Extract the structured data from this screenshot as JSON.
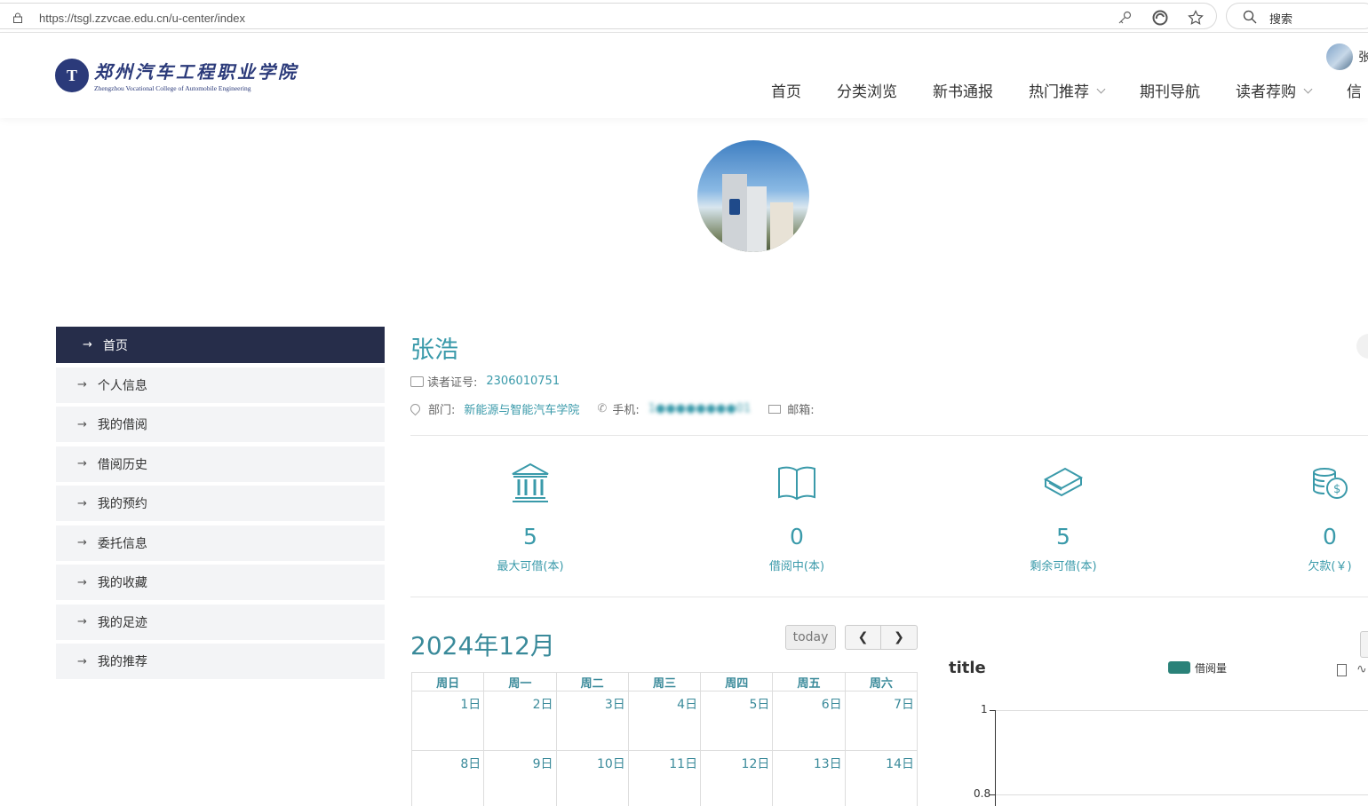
{
  "browser": {
    "url": "https://tsgl.zzvcae.edu.cn/u-center/index",
    "search_placeholder": "搜索"
  },
  "header": {
    "logo_cn": "郑州汽车工程职业学院",
    "logo_en": "Zhengzhou Vocational College of Automobile Engineering",
    "user_short": "张",
    "nav": [
      {
        "label": "首页",
        "dropdown": false
      },
      {
        "label": "分类浏览",
        "dropdown": false
      },
      {
        "label": "新书通报",
        "dropdown": false
      },
      {
        "label": "热门推荐",
        "dropdown": true
      },
      {
        "label": "期刊导航",
        "dropdown": false
      },
      {
        "label": "读者荐购",
        "dropdown": true
      },
      {
        "label": "信",
        "dropdown": false
      }
    ]
  },
  "sidebar": {
    "items": [
      {
        "label": "首页",
        "active": true
      },
      {
        "label": "个人信息",
        "active": false
      },
      {
        "label": "我的借阅",
        "active": false
      },
      {
        "label": "借阅历史",
        "active": false
      },
      {
        "label": "我的预约",
        "active": false
      },
      {
        "label": "委托信息",
        "active": false
      },
      {
        "label": "我的收藏",
        "active": false
      },
      {
        "label": "我的足迹",
        "active": false
      },
      {
        "label": "我的推荐",
        "active": false
      }
    ]
  },
  "user": {
    "name": "张浩",
    "card_label": "读者证号:",
    "card_no": "2306010751",
    "dept_label": "部门:",
    "dept": "新能源与智能汽车学院",
    "phone_label": "手机:",
    "phone": "1●●●●●●●●01",
    "email_label": "邮箱:"
  },
  "stats": [
    {
      "icon": "bank-icon",
      "value": "5",
      "label": "最大可借(本)"
    },
    {
      "icon": "open-book-icon",
      "value": "0",
      "label": "借阅中(本)"
    },
    {
      "icon": "book-stack-icon",
      "value": "5",
      "label": "剩余可借(本)"
    },
    {
      "icon": "coins-icon",
      "value": "0",
      "label": "欠款(￥)"
    }
  ],
  "calendar": {
    "title": "2024年12月",
    "today_label": "today",
    "weekdays": [
      "周日",
      "周一",
      "周二",
      "周三",
      "周四",
      "周五",
      "周六"
    ],
    "weeks": [
      [
        "1日",
        "2日",
        "3日",
        "4日",
        "5日",
        "6日",
        "7日"
      ],
      [
        "8日",
        "9日",
        "10日",
        "11日",
        "12日",
        "13日",
        "14日"
      ]
    ]
  },
  "chart": {
    "title": "title",
    "legend": "借阅量",
    "legend_color": "#2a8279",
    "yticks": [
      "1",
      "0.8"
    ]
  },
  "colors": {
    "accent": "#3a9aaa",
    "sidebar_active": "#262d4a"
  }
}
